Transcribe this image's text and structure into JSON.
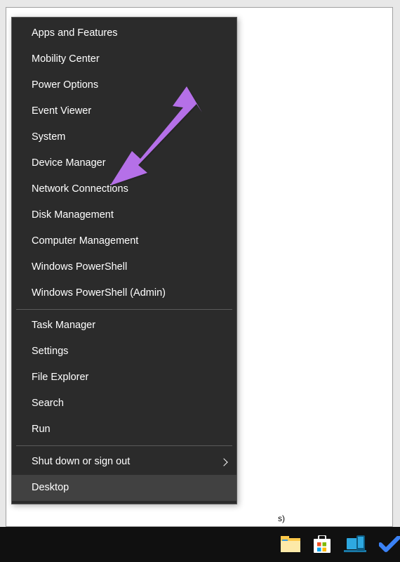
{
  "menu": {
    "groups": [
      [
        {
          "label": "Apps and Features",
          "submenu": false,
          "hovered": false
        },
        {
          "label": "Mobility Center",
          "submenu": false,
          "hovered": false
        },
        {
          "label": "Power Options",
          "submenu": false,
          "hovered": false
        },
        {
          "label": "Event Viewer",
          "submenu": false,
          "hovered": false
        },
        {
          "label": "System",
          "submenu": false,
          "hovered": false
        },
        {
          "label": "Device Manager",
          "submenu": false,
          "hovered": false
        },
        {
          "label": "Network Connections",
          "submenu": false,
          "hovered": false
        },
        {
          "label": "Disk Management",
          "submenu": false,
          "hovered": false
        },
        {
          "label": "Computer Management",
          "submenu": false,
          "hovered": false
        },
        {
          "label": "Windows PowerShell",
          "submenu": false,
          "hovered": false
        },
        {
          "label": "Windows PowerShell (Admin)",
          "submenu": false,
          "hovered": false
        }
      ],
      [
        {
          "label": "Task Manager",
          "submenu": false,
          "hovered": false
        },
        {
          "label": "Settings",
          "submenu": false,
          "hovered": false
        },
        {
          "label": "File Explorer",
          "submenu": false,
          "hovered": false
        },
        {
          "label": "Search",
          "submenu": false,
          "hovered": false
        },
        {
          "label": "Run",
          "submenu": false,
          "hovered": false
        }
      ],
      [
        {
          "label": "Shut down or sign out",
          "submenu": true,
          "hovered": false
        },
        {
          "label": "Desktop",
          "submenu": false,
          "hovered": true
        }
      ]
    ]
  },
  "taskbar": {
    "icons": [
      {
        "name": "file-explorer-icon"
      },
      {
        "name": "microsoft-store-icon"
      },
      {
        "name": "your-phone-icon"
      },
      {
        "name": "todo-icon"
      }
    ]
  },
  "annotation": {
    "arrow_color": "#b570e8",
    "target_label": "Device Manager"
  }
}
